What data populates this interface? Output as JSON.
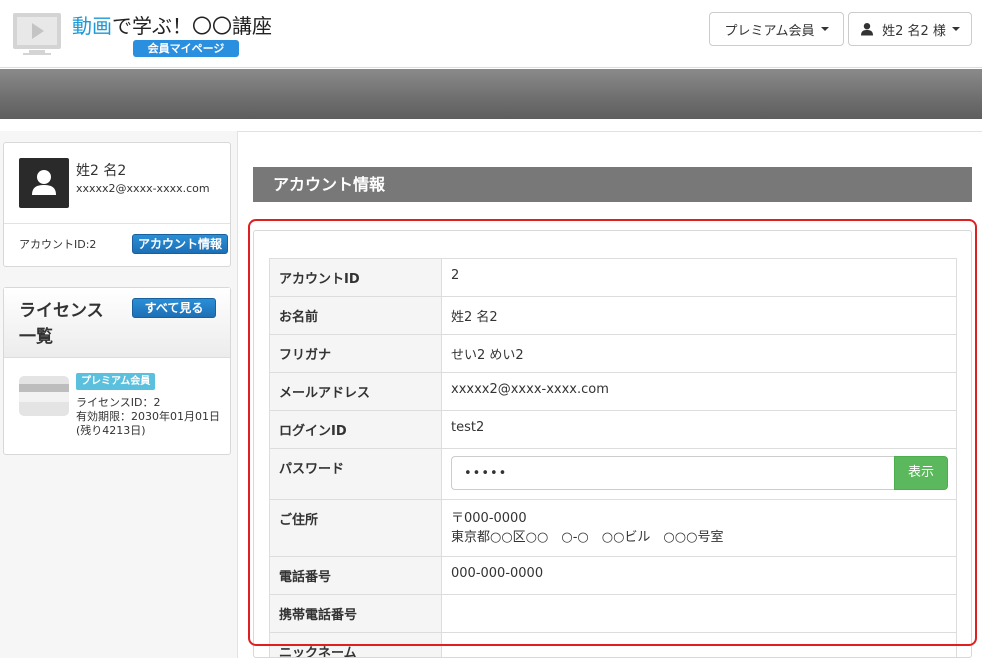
{
  "header": {
    "title_part1": "動画",
    "title_part2": "で学ぶ！〇〇講座",
    "mypage_badge": "会員マイページ",
    "premium_dropdown": "プレミアム会員",
    "user_dropdown": "姓2 名2 様"
  },
  "sidebar": {
    "profile": {
      "name": "姓2 名2",
      "email": "xxxxx2@xxxx-xxxx.com",
      "account_id_label": "アカウントID:2",
      "account_info_button": "アカウント情報"
    },
    "licenses": {
      "title": "ライセンス一覧",
      "see_all_button": "すべて見る",
      "items": [
        {
          "tag": "プレミアム会員",
          "license_id": "ライセンスID：2",
          "expiry": "有効期限：2030年01月01日",
          "remaining": "(残り4213日)"
        }
      ]
    }
  },
  "main": {
    "section_title": "アカウント情報",
    "rows": [
      {
        "label": "アカウントID",
        "value": "2"
      },
      {
        "label": "お名前",
        "value": "姓2 名2"
      },
      {
        "label": "フリガナ",
        "value": "せい2 めい2"
      },
      {
        "label": "メールアドレス",
        "value": "xxxxx2@xxxx-xxxx.com"
      },
      {
        "label": "ログインID",
        "value": "test2"
      },
      {
        "label": "パスワード",
        "value": "•••••",
        "button": "表示"
      },
      {
        "label": "ご住所",
        "value": "〒000-0000",
        "value2": "東京都○○区○○　○-○　○○ビル　○○○号室"
      },
      {
        "label": "電話番号",
        "value": "000-000-0000"
      },
      {
        "label": "携帯電話番号",
        "value": ""
      },
      {
        "label": "ニックネーム",
        "value": ""
      }
    ]
  },
  "colors": {
    "brand_blue": "#1a9ad6",
    "badge_blue": "#2b8fe0",
    "section_header": "#787878",
    "highlight_red": "#e02020",
    "show_button_green": "#5cb85c",
    "premium_tag": "#5bc0de"
  },
  "icons": {
    "logo": "video-screen-icon",
    "user": "user-icon",
    "avatar": "user-silhouette-icon",
    "card": "credit-card-icon"
  }
}
